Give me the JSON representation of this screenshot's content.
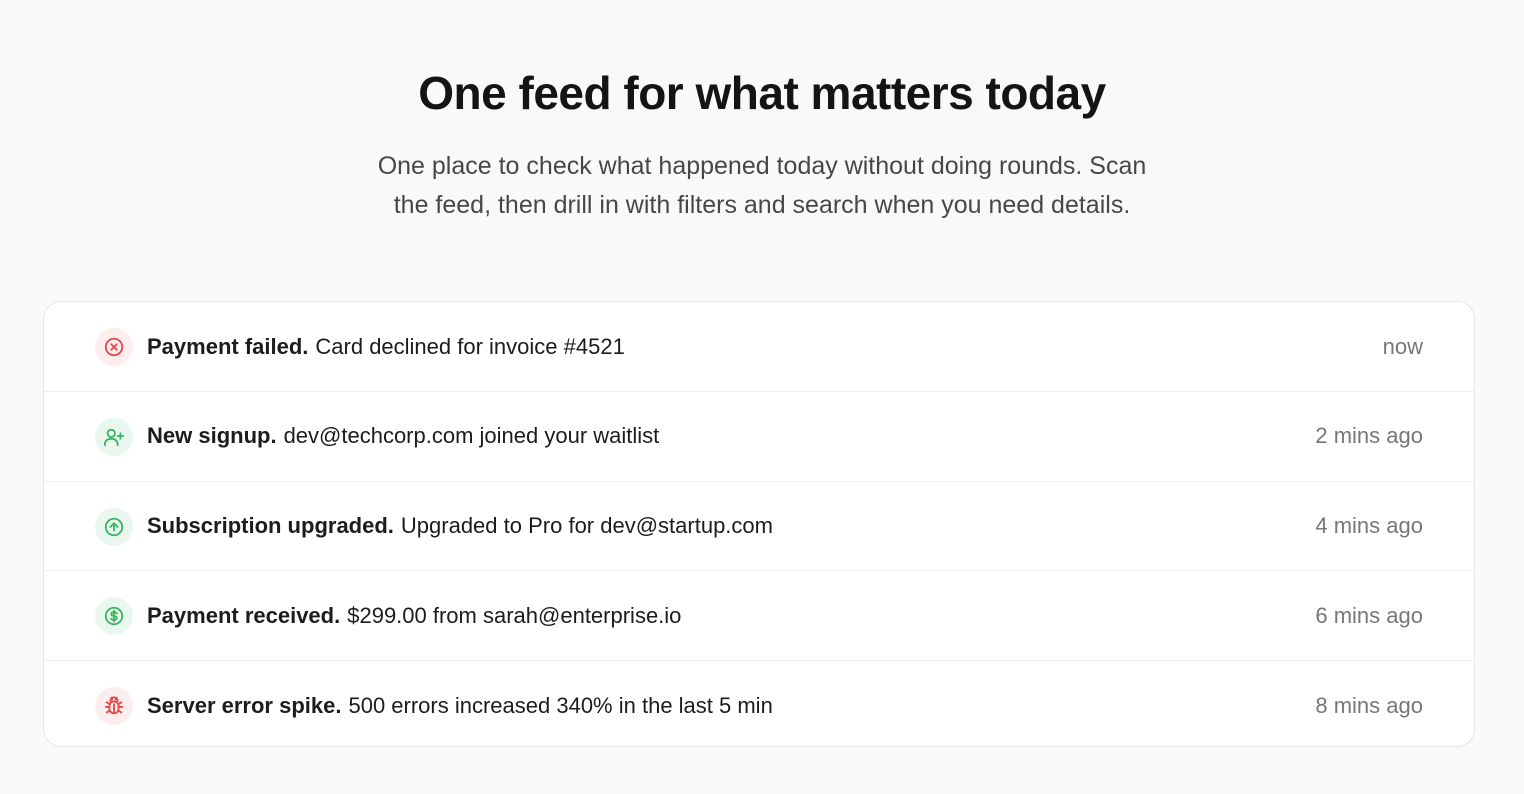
{
  "hero": {
    "title": "One feed for what matters today",
    "subtitle_line1": "One place to check what happened today without doing rounds. Scan",
    "subtitle_line2": "the feed, then drill in with filters and search when you need details."
  },
  "colors": {
    "error": "#e5484d",
    "success": "#3cb563",
    "error_bg": "#fdeeee",
    "success_bg": "#eaf7ee"
  },
  "feed": {
    "items": [
      {
        "icon": "x-circle-icon",
        "tone": "error",
        "title": "Payment failed.",
        "description": "Card declined for invoice #4521",
        "time": "now"
      },
      {
        "icon": "user-plus-icon",
        "tone": "success",
        "title": "New signup.",
        "description": "dev@techcorp.com joined your waitlist",
        "time": "2 mins ago"
      },
      {
        "icon": "arrow-up-circle-icon",
        "tone": "success",
        "title": "Subscription upgraded.",
        "description": "Upgraded to Pro for dev@startup.com",
        "time": "4 mins ago"
      },
      {
        "icon": "dollar-circle-icon",
        "tone": "success",
        "title": "Payment received.",
        "description": "$299.00 from sarah@enterprise.io",
        "time": "6 mins ago"
      },
      {
        "icon": "bug-icon",
        "tone": "error",
        "title": "Server error spike.",
        "description": "500 errors increased 340% in the last 5 min",
        "time": "8 mins ago"
      }
    ]
  }
}
